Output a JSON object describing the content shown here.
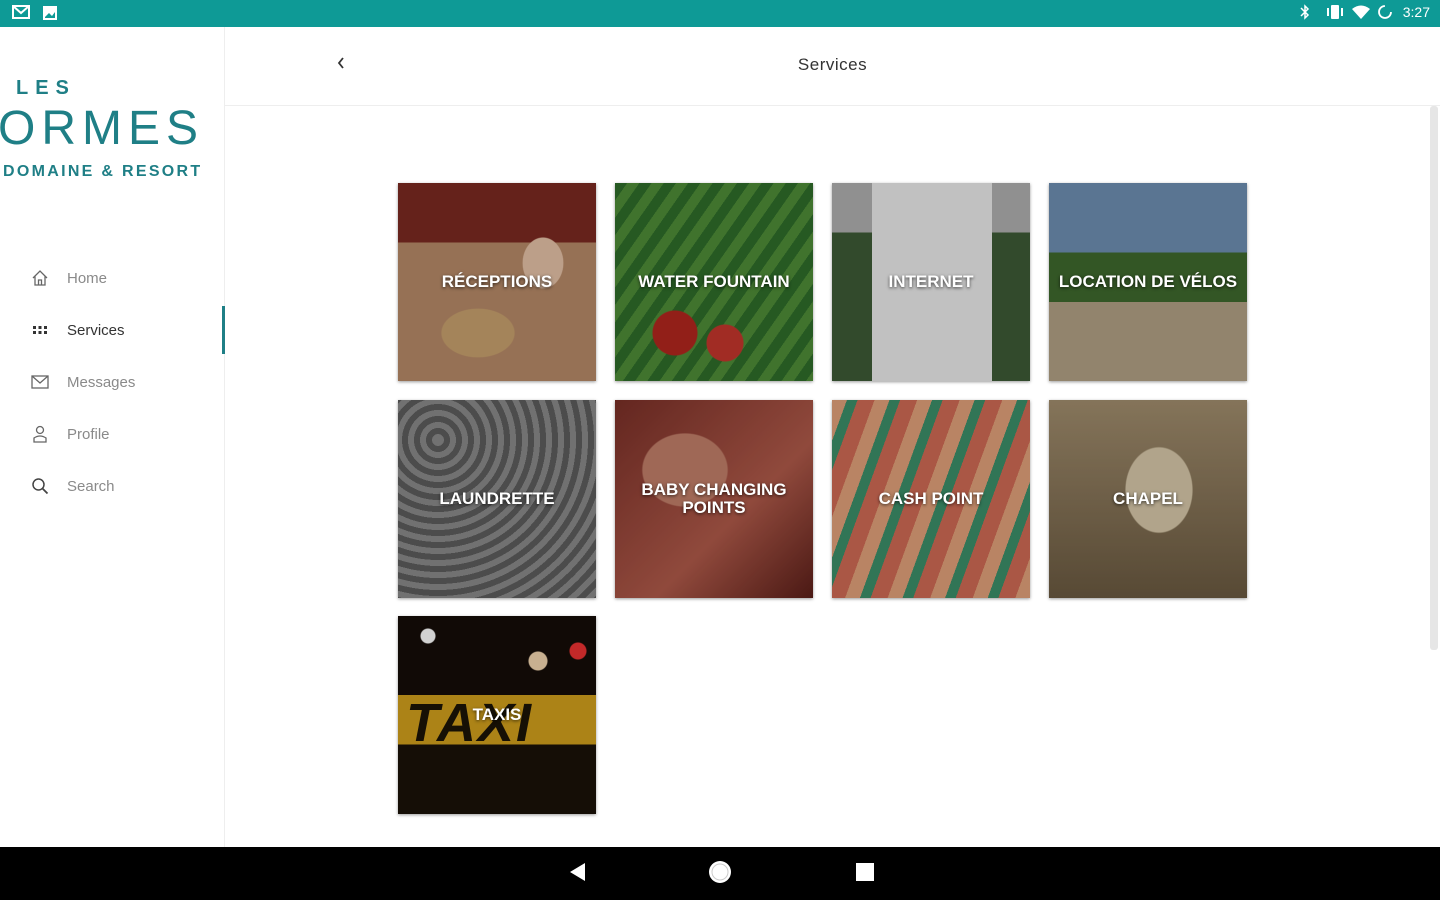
{
  "status_bar": {
    "time": "3:27",
    "left_icons": [
      "mail-icon",
      "image-icon"
    ],
    "right_icons": [
      "bluetooth-icon",
      "vibrate-icon",
      "wifi-icon",
      "sync-icon"
    ],
    "color": "#0e9a96"
  },
  "logo": {
    "les": "LES",
    "main": "ORMES",
    "sub": "DOMAINE & RESORT",
    "color": "#1f7f86"
  },
  "sidebar": {
    "items": [
      {
        "label": "Home",
        "icon": "home-icon"
      },
      {
        "label": "Services",
        "icon": "grid-icon",
        "active": true
      },
      {
        "label": "Messages",
        "icon": "mail-icon"
      },
      {
        "label": "Profile",
        "icon": "user-icon"
      },
      {
        "label": "Search",
        "icon": "search-icon"
      }
    ]
  },
  "header": {
    "title": "Services",
    "back_icon": "chevron-left-icon"
  },
  "tiles": [
    {
      "label": "RÉCEPTIONS"
    },
    {
      "label": "WATER FOUNTAIN"
    },
    {
      "label": "INTERNET"
    },
    {
      "label": "LOCATION DE VÉLOS"
    },
    {
      "label": "LAUNDRETTE"
    },
    {
      "label": "BABY CHANGING POINTS"
    },
    {
      "label": "CASH POINT"
    },
    {
      "label": "CHAPEL"
    },
    {
      "label": "TAXIS",
      "sign_text": "TAXI"
    }
  ],
  "android_nav": {
    "buttons": [
      "back-icon",
      "home-icon",
      "recents-icon"
    ]
  }
}
